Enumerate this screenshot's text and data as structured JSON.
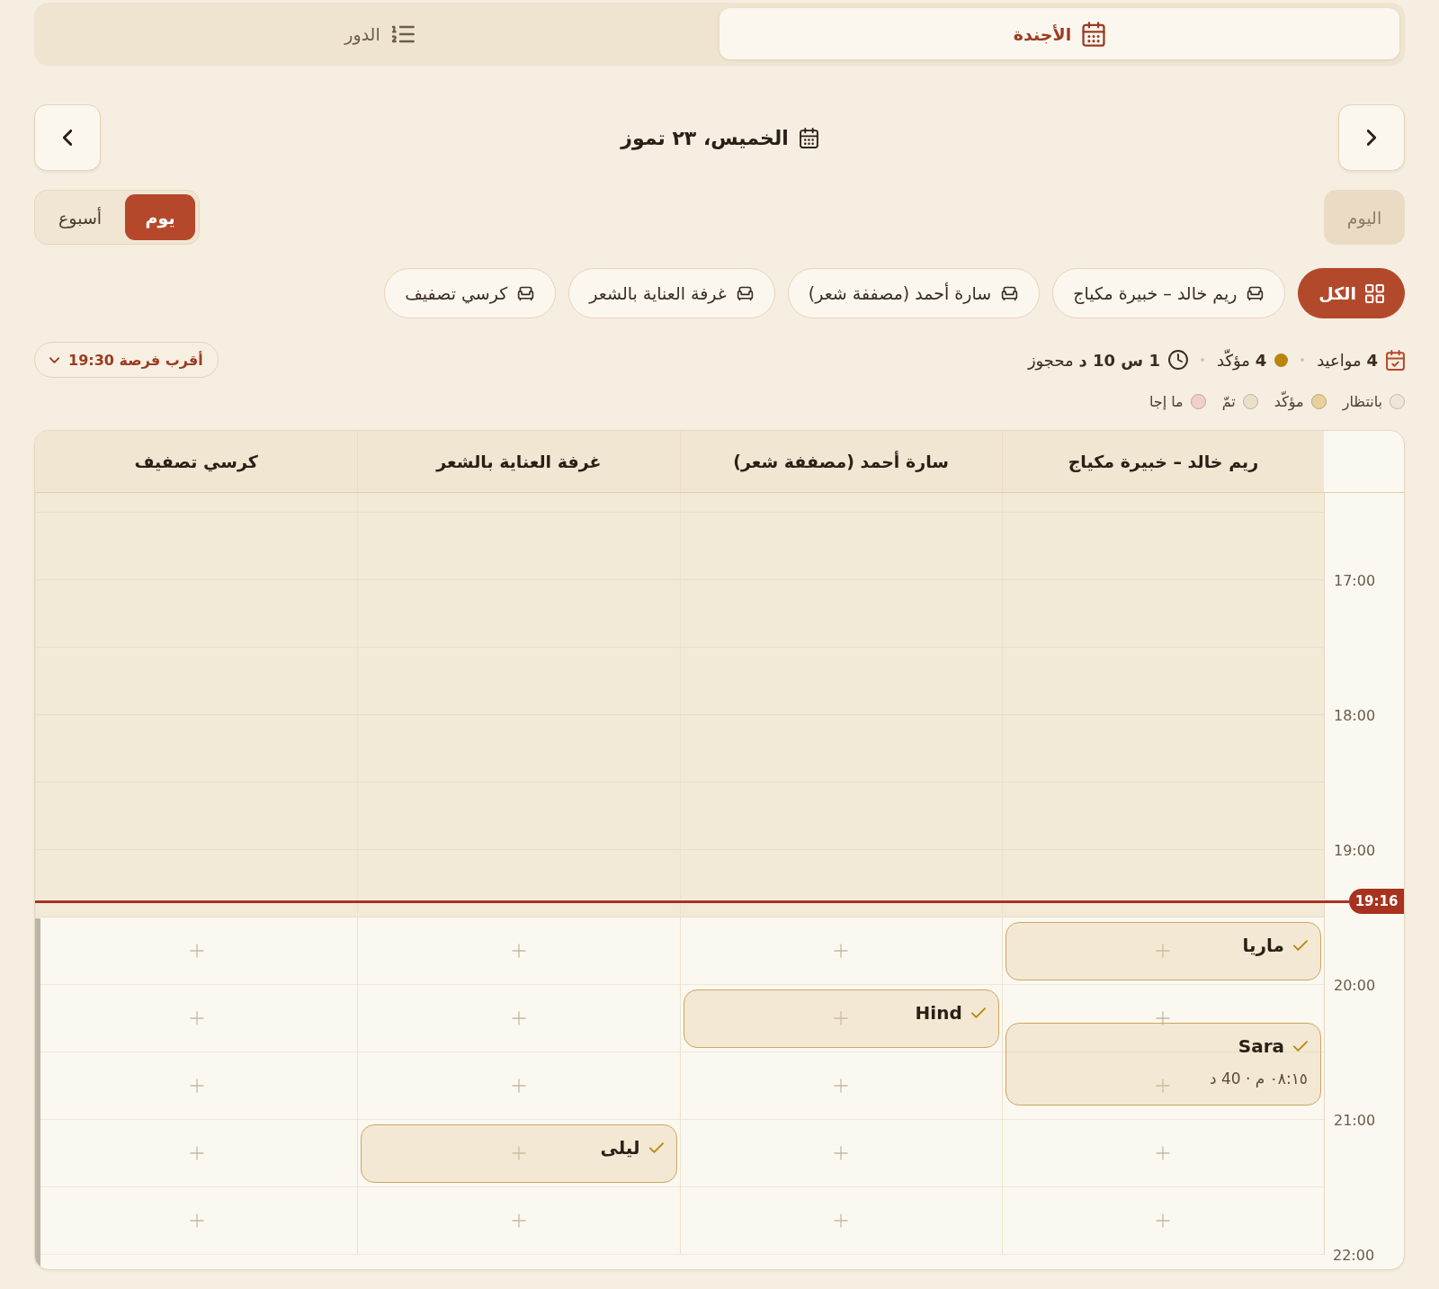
{
  "tabs": [
    {
      "label": "الأجندة",
      "kind": "agenda",
      "selected": true
    },
    {
      "label": "الدور",
      "kind": "queue",
      "selected": false
    }
  ],
  "date_title": "الخميس، ٢٣ تموز",
  "today_button": {
    "label": "اليوم",
    "disabled": true
  },
  "views": [
    {
      "label": "يوم",
      "selected": true
    },
    {
      "label": "أسبوع",
      "selected": false
    }
  ],
  "filters": [
    {
      "label": "الكل",
      "kind": "all",
      "selected": true
    },
    {
      "label": "ريم خالد – خبيرة مكياج",
      "kind": "resource",
      "selected": false
    },
    {
      "label": "سارة أحمد (مصففة شعر)",
      "kind": "resource",
      "selected": false
    },
    {
      "label": "غرفة العناية بالشعر",
      "kind": "resource",
      "selected": false
    },
    {
      "label": "كرسي تصفيف",
      "kind": "resource",
      "selected": false
    }
  ],
  "stats": [
    {
      "kind": "appointments",
      "text": "**4** مواعيد"
    },
    {
      "kind": "confirmed",
      "text": "**4** مؤكّد"
    },
    {
      "kind": "booked",
      "text": "**1 س 10 د** محجوز"
    }
  ],
  "next_slot": {
    "label": "أقرب فرصة 19:30"
  },
  "legend": [
    {
      "label": "بانتظار",
      "color": "#efe6d6"
    },
    {
      "label": "مؤكّد",
      "color": "#e8d09c"
    },
    {
      "label": "تمّ",
      "color": "#ecdfc9"
    },
    {
      "label": "ما إجا",
      "color": "#f0d0c9"
    }
  ],
  "grid": {
    "columns": [
      "ريم خالد – خبيرة مكياج",
      "سارة أحمد (مصففة شعر)",
      "غرفة العناية بالشعر",
      "كرسي تصفيف"
    ],
    "rows": [
      {
        "cells": [
          {
            "past": true
          },
          {
            "past": true
          },
          {
            "past": true
          },
          {
            "past": true
          }
        ]
      },
      {
        "cells": [
          {
            "past": true
          },
          {
            "past": true
          },
          {
            "past": true
          },
          {
            "past": true
          }
        ]
      },
      {
        "time": "17:00",
        "cells": [
          {
            "past": true
          },
          {
            "past": true
          },
          {
            "past": true
          },
          {
            "past": true
          }
        ]
      },
      {
        "cells": [
          {
            "past": true
          },
          {
            "past": true
          },
          {
            "past": true
          },
          {
            "past": true
          }
        ]
      },
      {
        "time": "18:00",
        "cells": [
          {
            "past": true
          },
          {
            "past": true
          },
          {
            "past": true
          },
          {
            "past": true
          }
        ]
      },
      {
        "cells": [
          {
            "past": true
          },
          {
            "past": true
          },
          {
            "past": true
          },
          {
            "past": true
          }
        ]
      },
      {
        "time": "19:00",
        "now": "19:16",
        "cells": [
          {
            "past": true
          },
          {
            "past": true
          },
          {
            "past": true
          },
          {
            "past": true
          }
        ]
      },
      {
        "cells": [
          {
            "past": false,
            "event": {
              "name": "ماريا",
              "confirmed": true,
              "kind": "slot"
            }
          },
          {
            "past": false
          },
          {
            "past": false
          },
          {
            "past": false
          }
        ]
      },
      {
        "time": "20:00",
        "cells": [
          {
            "past": false,
            "event": {
              "name": "Sara",
              "confirmed": true,
              "kind": "detailed",
              "detail": "٠٨:١٥ م · 40 د"
            }
          },
          {
            "past": false,
            "event": {
              "name": "Hind",
              "confirmed": true,
              "kind": "slot"
            }
          },
          {
            "past": false
          },
          {
            "past": false
          }
        ]
      },
      {
        "cells": [
          {
            "past": false
          },
          {
            "past": false
          },
          {
            "past": false
          },
          {
            "past": false
          }
        ]
      },
      {
        "time": "21:00",
        "cells": [
          {
            "past": false
          },
          {
            "past": false
          },
          {
            "past": false,
            "event": {
              "name": "ليلى",
              "confirmed": true,
              "kind": "slot"
            }
          },
          {
            "past": false
          }
        ]
      },
      {
        "cells": [
          {
            "past": false
          },
          {
            "past": false
          },
          {
            "past": false
          },
          {
            "past": false
          }
        ]
      }
    ],
    "end_time": "22:00"
  }
}
